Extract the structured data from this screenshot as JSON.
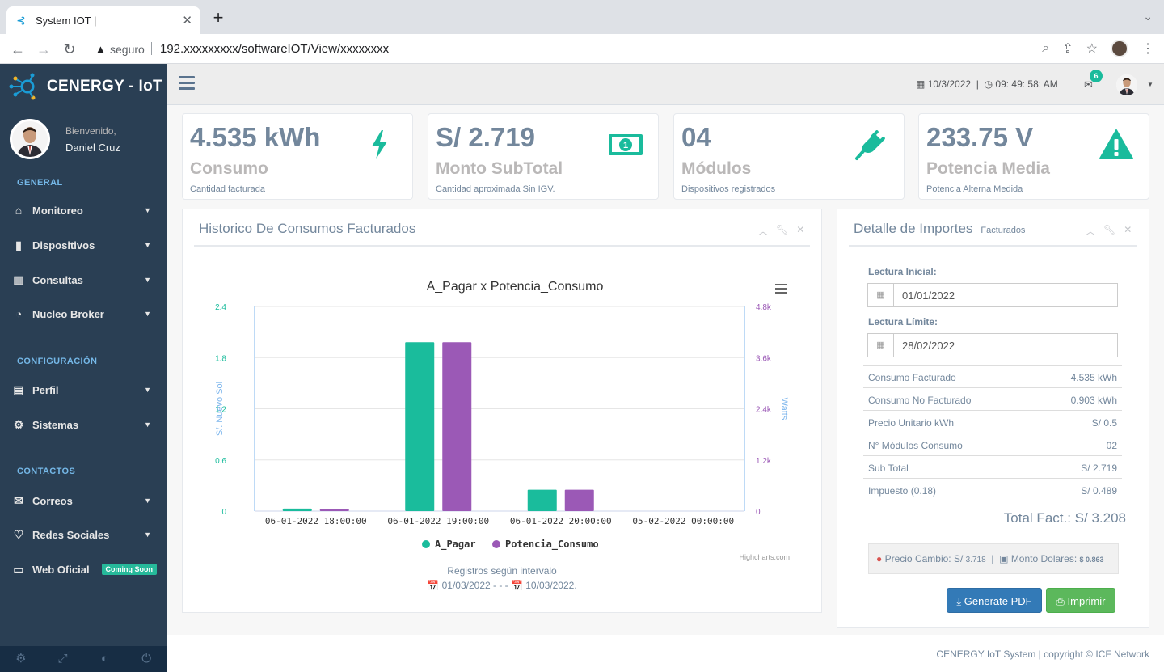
{
  "browser": {
    "tab_title": "System IOT |",
    "tab_close": "✕",
    "new_tab": "+",
    "secure_label": "seguro",
    "url": "192.xxxxxxxxx/softwareIOT/View/xxxxxxxx"
  },
  "brand": {
    "name": "CENERGY - IoT"
  },
  "profile": {
    "greeting": "Bienvenido,",
    "user": "Daniel Cruz"
  },
  "sidebar": {
    "sections": {
      "general": "GENERAL",
      "config": "CONFIGURACIÓN",
      "contacts": "CONTACTOS"
    },
    "items": [
      {
        "label": "Monitoreo",
        "icon": "home-icon"
      },
      {
        "label": "Dispositivos",
        "icon": "device-icon"
      },
      {
        "label": "Consultas",
        "icon": "bar-chart-icon"
      },
      {
        "label": "Nucleo Broker",
        "icon": "dashboard-icon"
      },
      {
        "label": "Perfil",
        "icon": "id-card-icon"
      },
      {
        "label": "Sistemas",
        "icon": "cogs-icon"
      },
      {
        "label": "Correos",
        "icon": "envelope-icon"
      },
      {
        "label": "Redes Sociales",
        "icon": "heart-icon"
      },
      {
        "label": "Web Oficial",
        "icon": "laptop-icon",
        "badge": "Coming Soon"
      }
    ]
  },
  "topbar": {
    "date": "10/3/2022",
    "time": "09: 49: 58: AM",
    "mail_count": "6"
  },
  "tiles": [
    {
      "value": "4.535 kWh",
      "label": "Consumo",
      "sub": "Cantidad facturada",
      "icon": "bolt-icon"
    },
    {
      "value": "S/ 2.719",
      "label": "Monto SubTotal",
      "sub": "Cantidad aproximada Sin IGV.",
      "icon": "money-icon"
    },
    {
      "value": "04",
      "label": "Módulos",
      "sub": "Dispositivos registrados",
      "icon": "plug-icon"
    },
    {
      "value": "233.75 V",
      "label": "Potencia Media",
      "sub": "Potencia Alterna Medida",
      "icon": "warning-icon"
    }
  ],
  "history_panel": {
    "title": "Historico De Consumos Facturados",
    "footer_line1": "Registros según intervalo",
    "footer_line2": "📅 01/03/2022 - - - 📅 10/03/2022."
  },
  "chart_data": {
    "type": "bar",
    "title": "A_Pagar x Potencia_Consumo",
    "credit": "Highcharts.com",
    "categories": [
      "06-01-2022 18:00:00",
      "06-01-2022 19:00:00",
      "06-01-2022 20:00:00",
      "05-02-2022 00:00:00"
    ],
    "y_left": {
      "label": "S/. Nuevo Sol",
      "min": 0,
      "max": 2.4,
      "ticks": [
        "0",
        "0.6",
        "1.2",
        "1.8",
        "2.4"
      ]
    },
    "y_right": {
      "label": "Watts",
      "min": 0,
      "max": 4800,
      "ticks": [
        "0",
        "1.2k",
        "2.4k",
        "3.6k",
        "4.8k"
      ]
    },
    "series": [
      {
        "name": "A_Pagar",
        "color": "#1abc9c",
        "axis": "left",
        "values": [
          0.03,
          1.98,
          0.25,
          0
        ]
      },
      {
        "name": "Potencia_Consumo",
        "color": "#9b59b6",
        "axis": "right",
        "values": [
          50,
          3960,
          500,
          0
        ]
      }
    ],
    "legend": "bottom"
  },
  "detail_panel": {
    "title": "Detalle de Importes",
    "subtitle": "Facturados",
    "start_label": "Lectura Inicial:",
    "start_value": "01/01/2022",
    "end_label": "Lectura Límite:",
    "end_value": "28/02/2022",
    "rows": [
      {
        "label": "Consumo Facturado",
        "value": "4.535 kWh"
      },
      {
        "label": "Consumo No Facturado",
        "value": "0.903 kWh"
      },
      {
        "label": "Precio Unitario kWh",
        "value": "S/ 0.5"
      },
      {
        "label": "N° Módulos Consumo",
        "value": "02"
      },
      {
        "label": "Sub Total",
        "value": "S/ 2.719"
      },
      {
        "label": "Impuesto (0.18)",
        "value": "S/ 0.489"
      }
    ],
    "total": "Total Fact.: S/ 3.208",
    "exchange_label": "Precio Cambio: S/",
    "exchange_value": "3.718",
    "dollars_label": "Monto Dolares:",
    "dollars_value": "$ 0.863",
    "pdf_button": "Generate PDF",
    "print_button": "Imprimir"
  },
  "footer": {
    "text": "CENERGY IoT System | copyright © ICF Network"
  }
}
